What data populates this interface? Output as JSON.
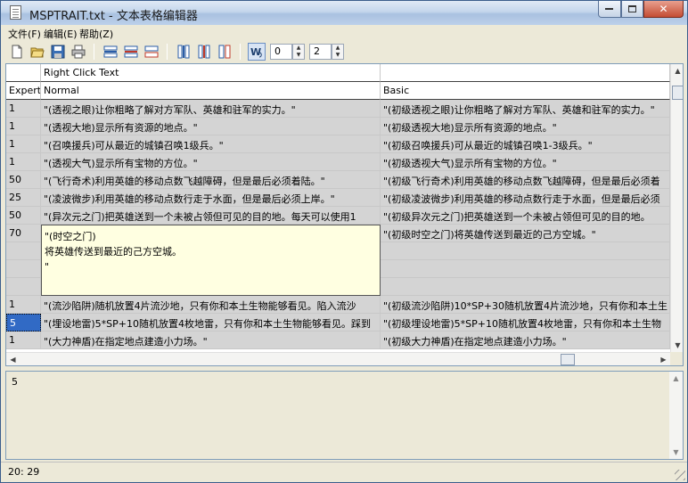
{
  "window": {
    "title": "MSPTRAIT.txt - 文本表格编辑器"
  },
  "menu": [
    "文件(F)",
    "编辑(E)",
    "帮助(Z)"
  ],
  "toolbar": {
    "buttons": [
      "new-file-icon",
      "open-folder-icon",
      "save-icon",
      "print-icon",
      "insert-row-icon",
      "delete-row-icon",
      "row-icon",
      "insert-column-icon",
      "delete-column-icon",
      "column-icon",
      "word-wrap-icon"
    ],
    "spin1_value": "0",
    "spin2_value": "2"
  },
  "grid": {
    "header_row1": [
      "",
      "Right Click Text",
      ""
    ],
    "header_row2": [
      "Expert",
      "Normal",
      "Basic"
    ],
    "rows": [
      [
        "1",
        "\"(透视之眼)让你粗略了解对方军队、英雄和驻军的实力。\"",
        "\"(初级透视之眼)让你粗略了解对方军队、英雄和驻军的实力。\""
      ],
      [
        "1",
        "\"(透视大地)显示所有资源的地点。\"",
        "\"(初级透视大地)显示所有资源的地点。\""
      ],
      [
        "1",
        "\"(召唤援兵)可从最近的城镇召唤1级兵。\"",
        "\"(初级召唤援兵)可从最近的城镇召唤1-3级兵。\""
      ],
      [
        "1",
        "\"(透视大气)显示所有宝物的方位。\"",
        "\"(初级透视大气)显示所有宝物的方位。\""
      ],
      [
        "50",
        "\"(飞行奇术)利用英雄的移动点数飞越障碍，但是最后必须着陆。\"",
        "\"(初级飞行奇术)利用英雄的移动点数飞越障碍，但是最后必须着"
      ],
      [
        "25",
        "\"(凌波微步)利用英雄的移动点数行走于水面，但是最后必须上岸。\"",
        "\"(初级凌波微步)利用英雄的移动点数行走于水面，但是最后必须"
      ],
      [
        "50",
        "\"(异次元之门)把英雄送到一个未被占领但可见的目的地。每天可以使用1",
        "\"(初级异次元之门)把英雄送到一个未被占领但可见的目的地。"
      ],
      [
        "70",
        "",
        "\"(初级时空之门)将英雄传送到最近的己方空城。\""
      ],
      [
        "",
        "",
        ""
      ],
      [
        "",
        "",
        ""
      ],
      [
        "",
        "",
        ""
      ],
      [
        "1",
        "\"(流沙陷阱)随机放置4片流沙地，只有你和本土生物能够看见。陷入流沙",
        "\"(初级流沙陷阱)10*SP+30随机放置4片流沙地，只有你和本土生"
      ],
      [
        "5",
        "\"(埋设地雷)5*SP+10随机放置4枚地雷，只有你和本土生物能够看见。踩到",
        "\"(初级埋设地雷)5*SP+10随机放置4枚地雷，只有你和本土生物"
      ],
      [
        "1",
        "\"(大力神盾)在指定地点建造小力场。\"",
        "\"(初级大力神盾)在指定地点建造小力场。\""
      ]
    ],
    "editor_popup": [
      "\"(时空之门)",
      "将英雄传送到最近的己方空城。",
      "\""
    ]
  },
  "detail": {
    "text": "5"
  },
  "status": {
    "position": "20:  29"
  }
}
